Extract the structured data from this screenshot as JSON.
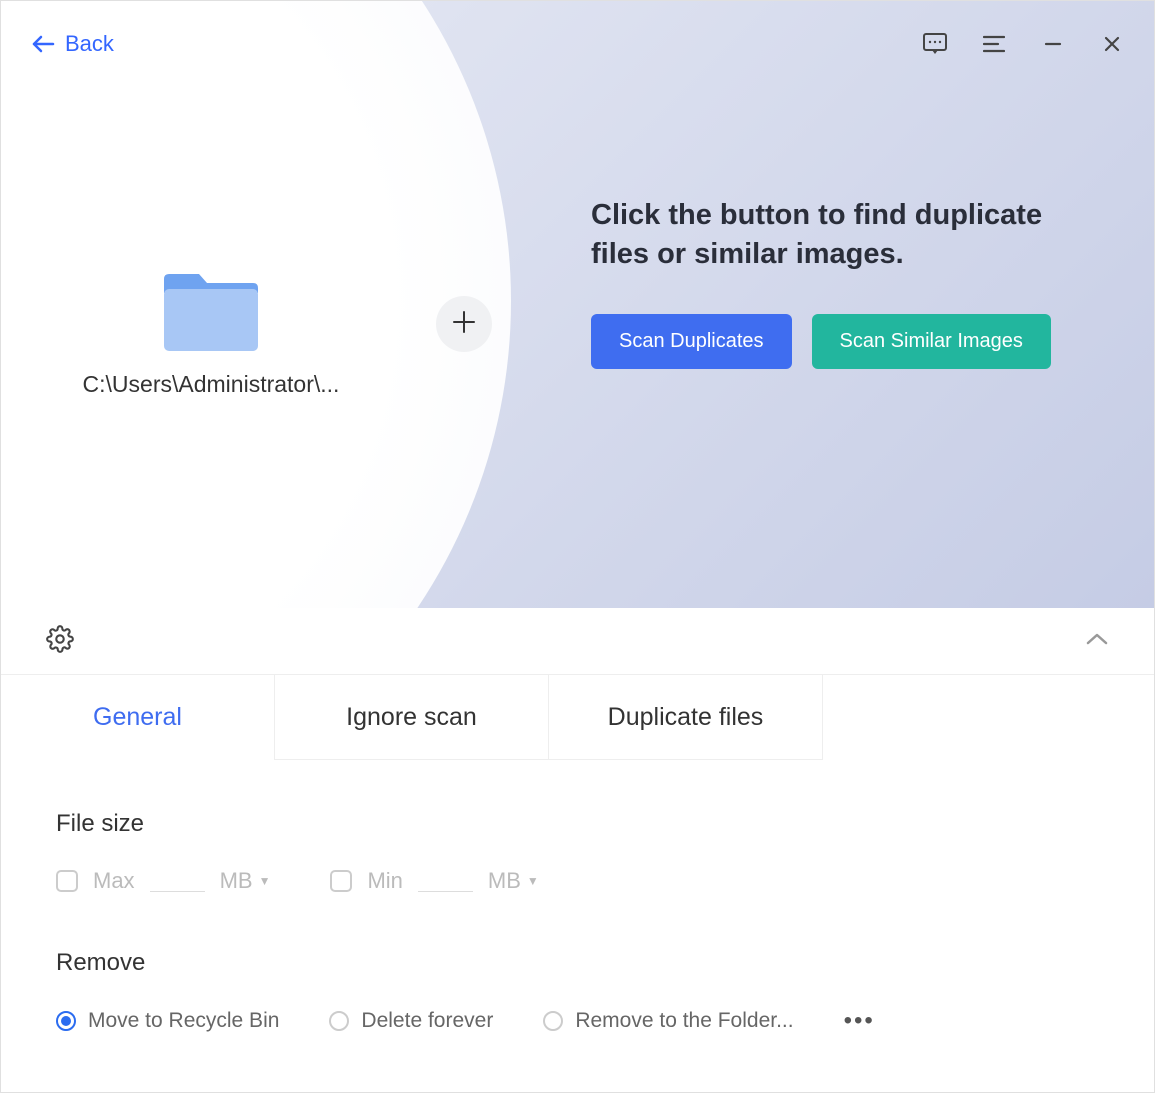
{
  "header": {
    "back_label": "Back"
  },
  "folder": {
    "path": "C:\\Users\\Administrator\\..."
  },
  "instruction": {
    "text": "Click the button to find duplicate files or similar images."
  },
  "buttons": {
    "scan_duplicates": "Scan Duplicates",
    "scan_similar": "Scan Similar Images"
  },
  "tabs": {
    "general": "General",
    "ignore": "Ignore scan",
    "duplicates": "Duplicate files"
  },
  "settings": {
    "filesize_title": "File size",
    "max_label": "Max",
    "min_label": "Min",
    "unit_max": "MB",
    "unit_min": "MB",
    "remove_title": "Remove",
    "remove_options": {
      "recycle": "Move to Recycle Bin",
      "delete": "Delete forever",
      "folder": "Remove to the Folder..."
    },
    "more": "•••"
  }
}
